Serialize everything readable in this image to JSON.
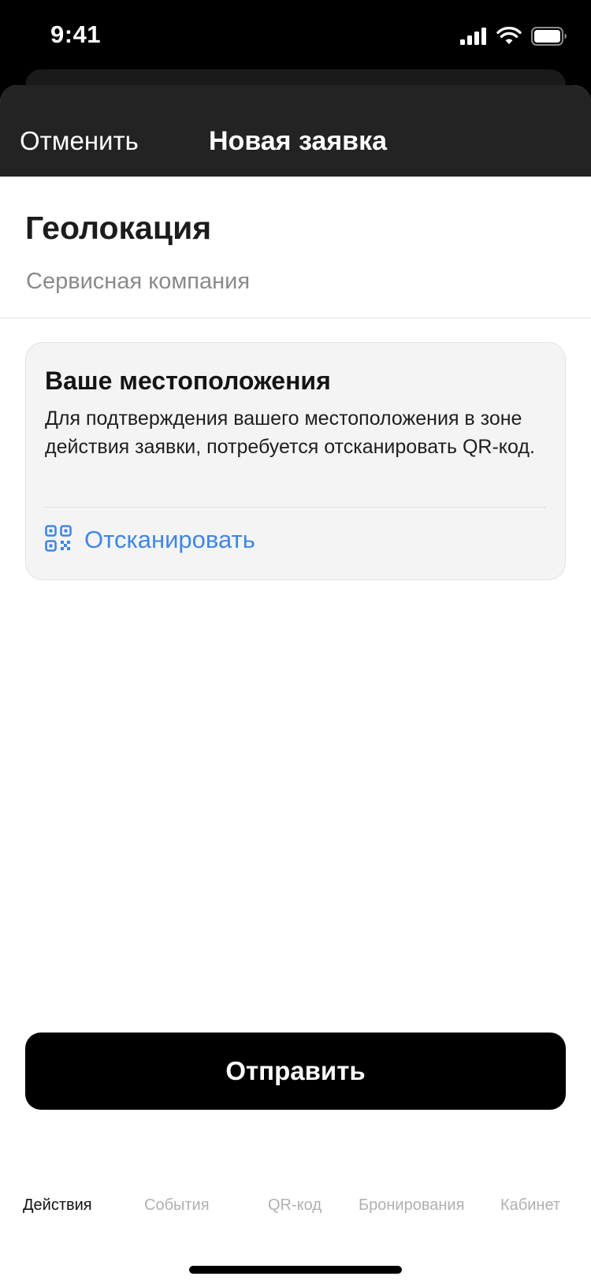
{
  "status_bar": {
    "time": "9:41",
    "icons": [
      "signal-icon",
      "wifi-icon",
      "battery-icon"
    ]
  },
  "nav": {
    "cancel_label": "Отменить",
    "title": "Новая заявка"
  },
  "header": {
    "title": "Геолокация",
    "subtitle": "Сервисная компания"
  },
  "location_card": {
    "title": "Ваше местоположения",
    "description": "Для подтверждения вашего местоположения в зоне действия заявки, потребуется отсканировать QR-код.",
    "scan_label": "Отсканировать",
    "scan_icon": "qr-code-icon"
  },
  "submit_label": "Отправить",
  "tabs": [
    {
      "label": "Действия",
      "active": true
    },
    {
      "label": "События",
      "active": false
    },
    {
      "label": "QR-код",
      "active": false
    },
    {
      "label": "Бронирования",
      "active": false
    },
    {
      "label": "Кабинет",
      "active": false
    }
  ],
  "colors": {
    "accent": "#3f86e8",
    "nav_background": "#232323",
    "card_background": "#f4f4f4",
    "button_background": "#000000"
  }
}
